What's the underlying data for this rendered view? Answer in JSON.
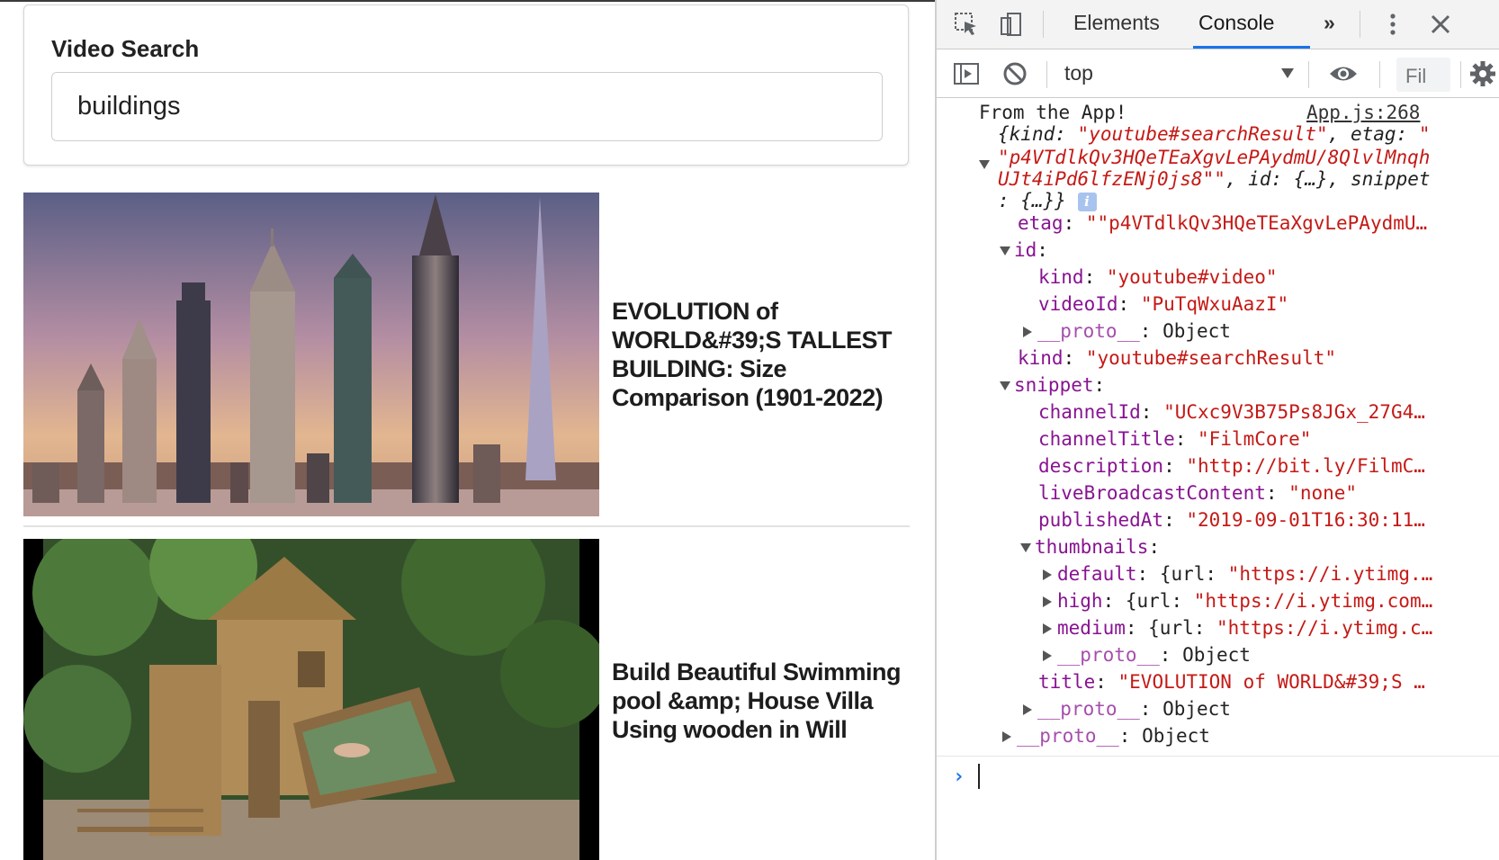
{
  "app": {
    "search_label": "Video Search",
    "search_value": "buildings",
    "videos": [
      {
        "title": "EVOLUTION of WORLD&#39;S TALLEST BUILDING: Size Comparison (1901-2022)"
      },
      {
        "title": "Build Beautiful Swimming pool &amp; House Villa Using wooden in Will"
      }
    ]
  },
  "devtools": {
    "tabs": {
      "elements": "Elements",
      "console": "Console",
      "more": "»"
    },
    "context": "top",
    "filter_placeholder": "Fil",
    "log": {
      "message": "From the App!",
      "source": "App.js:268",
      "summary": {
        "open": "{",
        "kind_key": "kind",
        "kind_val": "\"youtube#searchResult\"",
        "etag_key": "etag",
        "etag_val_1": "\"",
        "etag_val_2": "\"p4VTdlkQv3HQeTEaXgvLePAydmU/8QlvlMnqh",
        "etag_val_3": "UJt4iPd6lfzENj0js8\"\"",
        "id_key": "id",
        "collapsed": "{…}",
        "snippet_key": "snippet",
        "tail": ": {…}}"
      },
      "etag_line_key": "etag",
      "etag_line_val": "\"\"p4VTdlkQv3HQeTEaXgvLePAydmU…",
      "id_key": "id",
      "id_kind_key": "kind",
      "id_kind_val": "\"youtube#video\"",
      "id_videoId_key": "videoId",
      "id_videoId_val": "\"PuTqWxuAazI\"",
      "proto_key": "__proto__",
      "proto_val": "Object",
      "kind_key": "kind",
      "kind_val": "\"youtube#searchResult\"",
      "snippet_key": "snippet",
      "channelId_key": "channelId",
      "channelId_val": "\"UCxc9V3B75Ps8JGx_27G4…",
      "channelTitle_key": "channelTitle",
      "channelTitle_val": "\"FilmCore\"",
      "description_key": "description",
      "description_val": "\"http://bit.ly/FilmC…",
      "live_key": "liveBroadcastContent",
      "live_val": "\"none\"",
      "published_key": "publishedAt",
      "published_val": "\"2019-09-01T16:30:11…",
      "thumbnails_key": "thumbnails",
      "default_key": "default",
      "default_val_pre": "{url: ",
      "default_val": "\"https://i.ytimg.…",
      "high_key": "high",
      "high_val_pre": "{url: ",
      "high_val": "\"https://i.ytimg.com…",
      "medium_key": "medium",
      "medium_val_pre": "{url: ",
      "medium_val": "\"https://i.ytimg.c…",
      "title_key": "title",
      "title_val": "\"EVOLUTION of WORLD&#39;S …"
    }
  }
}
